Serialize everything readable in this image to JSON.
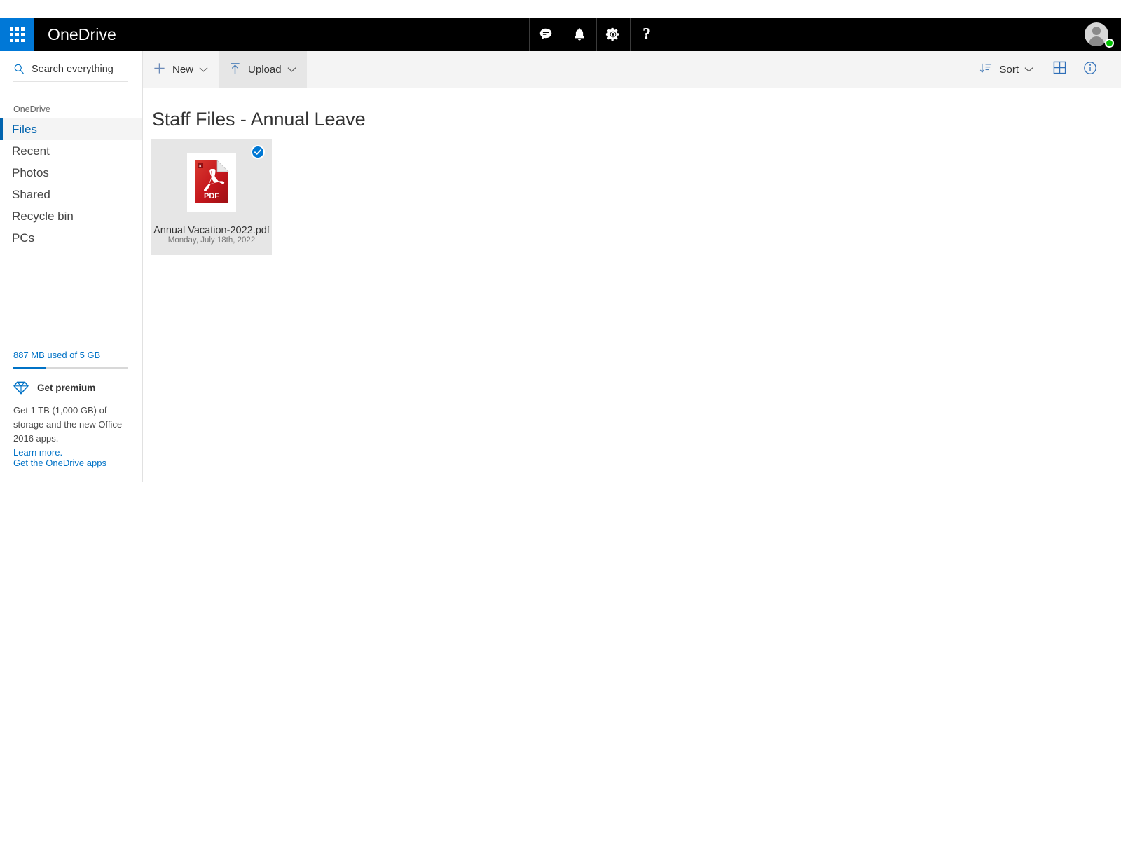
{
  "suite": {
    "waffle_name": "app-launcher",
    "brand": "OneDrive",
    "actions": [
      {
        "name": "chat-icon",
        "label": "Chat"
      },
      {
        "name": "bell-icon",
        "label": "Notifications"
      },
      {
        "name": "gear-icon",
        "label": "Settings"
      },
      {
        "name": "help-icon",
        "label": "?"
      }
    ],
    "avatar_label": "Account manager",
    "presence": "available"
  },
  "search": {
    "placeholder": "Search everything",
    "value": "",
    "icon": "search-icon"
  },
  "sidebar": {
    "heading": "OneDrive",
    "items": [
      {
        "label": "Files",
        "selected": true
      },
      {
        "label": "Recent",
        "selected": false
      },
      {
        "label": "Photos",
        "selected": false
      },
      {
        "label": "Shared",
        "selected": false
      },
      {
        "label": "Recycle bin",
        "selected": false
      },
      {
        "label": "PCs",
        "selected": false
      }
    ],
    "storage": {
      "text": "887 MB used of 5 GB",
      "used_percent": 28
    },
    "promo": {
      "icon": "diamond-icon",
      "title": "Get premium",
      "body": "Get 1 TB (1,000 GB) of storage and the new Office 2016 apps.",
      "learn_more": "Learn more."
    },
    "apps_link": "Get the OneDrive apps"
  },
  "commandbar": {
    "new_label": "New",
    "upload_label": "Upload",
    "sort_label": "Sort",
    "view_icon": "tiles-view-icon",
    "info_icon": "info-icon"
  },
  "main": {
    "title": "Staff Files - Annual Leave",
    "items": [
      {
        "name": "Annual Vacation-2022.pdf",
        "date": "Monday, July 18th, 2022",
        "type": "pdf",
        "selected": true
      }
    ]
  },
  "colors": {
    "accent": "#0078d7",
    "link": "#0072c6",
    "selected_nav": "#0063ae",
    "suite_bar": "#000000",
    "tile_bg": "#e6e6e6",
    "pdf_red": "#c4161c",
    "presence_green": "#00c000"
  }
}
